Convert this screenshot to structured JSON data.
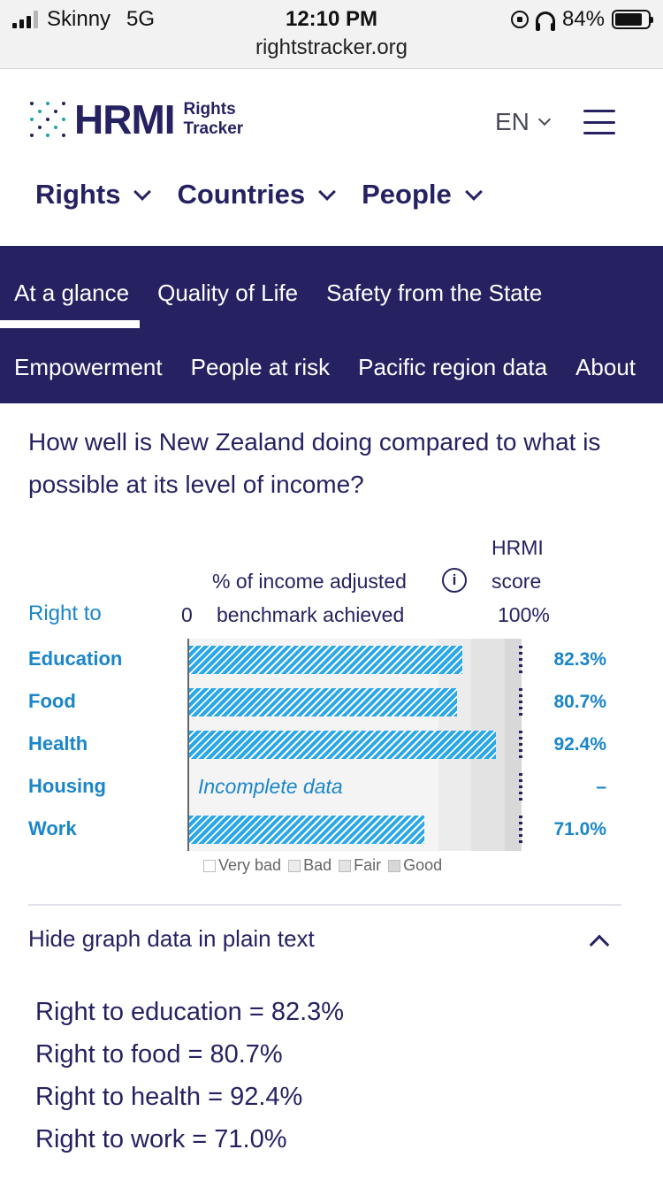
{
  "status_bar": {
    "carrier": "Skinny",
    "network": "5G",
    "time": "12:10 PM",
    "url": "rightstracker.org",
    "battery_percent": "84%"
  },
  "header": {
    "logo": "HRMI",
    "logo_sub_1": "Rights",
    "logo_sub_2": "Tracker",
    "language": "EN",
    "icons": [
      "menu-icon",
      "chevron-down-icon"
    ]
  },
  "main_nav": [
    "Rights",
    "Countries",
    "People"
  ],
  "tabs": {
    "row1": [
      "At a glance",
      "Quality of Life",
      "Safety from the State"
    ],
    "row2": [
      "Empowerment",
      "People at risk",
      "Pacific region data",
      "About"
    ],
    "active": "At a glance"
  },
  "question": "How well is New Zealand doing compared to what is possible at its level of income?",
  "chart_headers": {
    "right_to": "Right to",
    "zero": "0",
    "pct_line1": "% of income adjusted",
    "pct_line2": "benchmark achieved",
    "hrmi_line1": "HRMI",
    "hrmi_line2": "score",
    "hundred": "100%"
  },
  "chart_data": {
    "type": "bar",
    "orientation": "horizontal",
    "categories": [
      "Education",
      "Food",
      "Health",
      "Housing",
      "Work"
    ],
    "values": [
      82.3,
      80.7,
      92.4,
      null,
      71.0
    ],
    "value_labels": [
      "82.3%",
      "80.7%",
      "92.4%",
      "–",
      "71.0%"
    ],
    "missing_label": "Incomplete data",
    "xlim": [
      0,
      100
    ],
    "bands": [
      {
        "name": "Very bad",
        "from": 0,
        "to": 75,
        "color": "#f4f4f4"
      },
      {
        "name": "Bad",
        "from": 75,
        "to": 85,
        "color": "#ececec"
      },
      {
        "name": "Fair",
        "from": 85,
        "to": 95,
        "color": "#e3e3e3"
      },
      {
        "name": "Good",
        "from": 95,
        "to": 100,
        "color": "#d8d8d8"
      }
    ],
    "legend": [
      "Very bad",
      "Bad",
      "Fair",
      "Good"
    ],
    "bar_color": "#2aa7e6"
  },
  "plain_text": {
    "toggle_label": "Hide graph data in plain text",
    "lines": [
      "Right to education = 82.3%",
      "Right to food = 80.7%",
      "Right to health = 92.4%",
      "Right to work = 71.0%"
    ]
  }
}
